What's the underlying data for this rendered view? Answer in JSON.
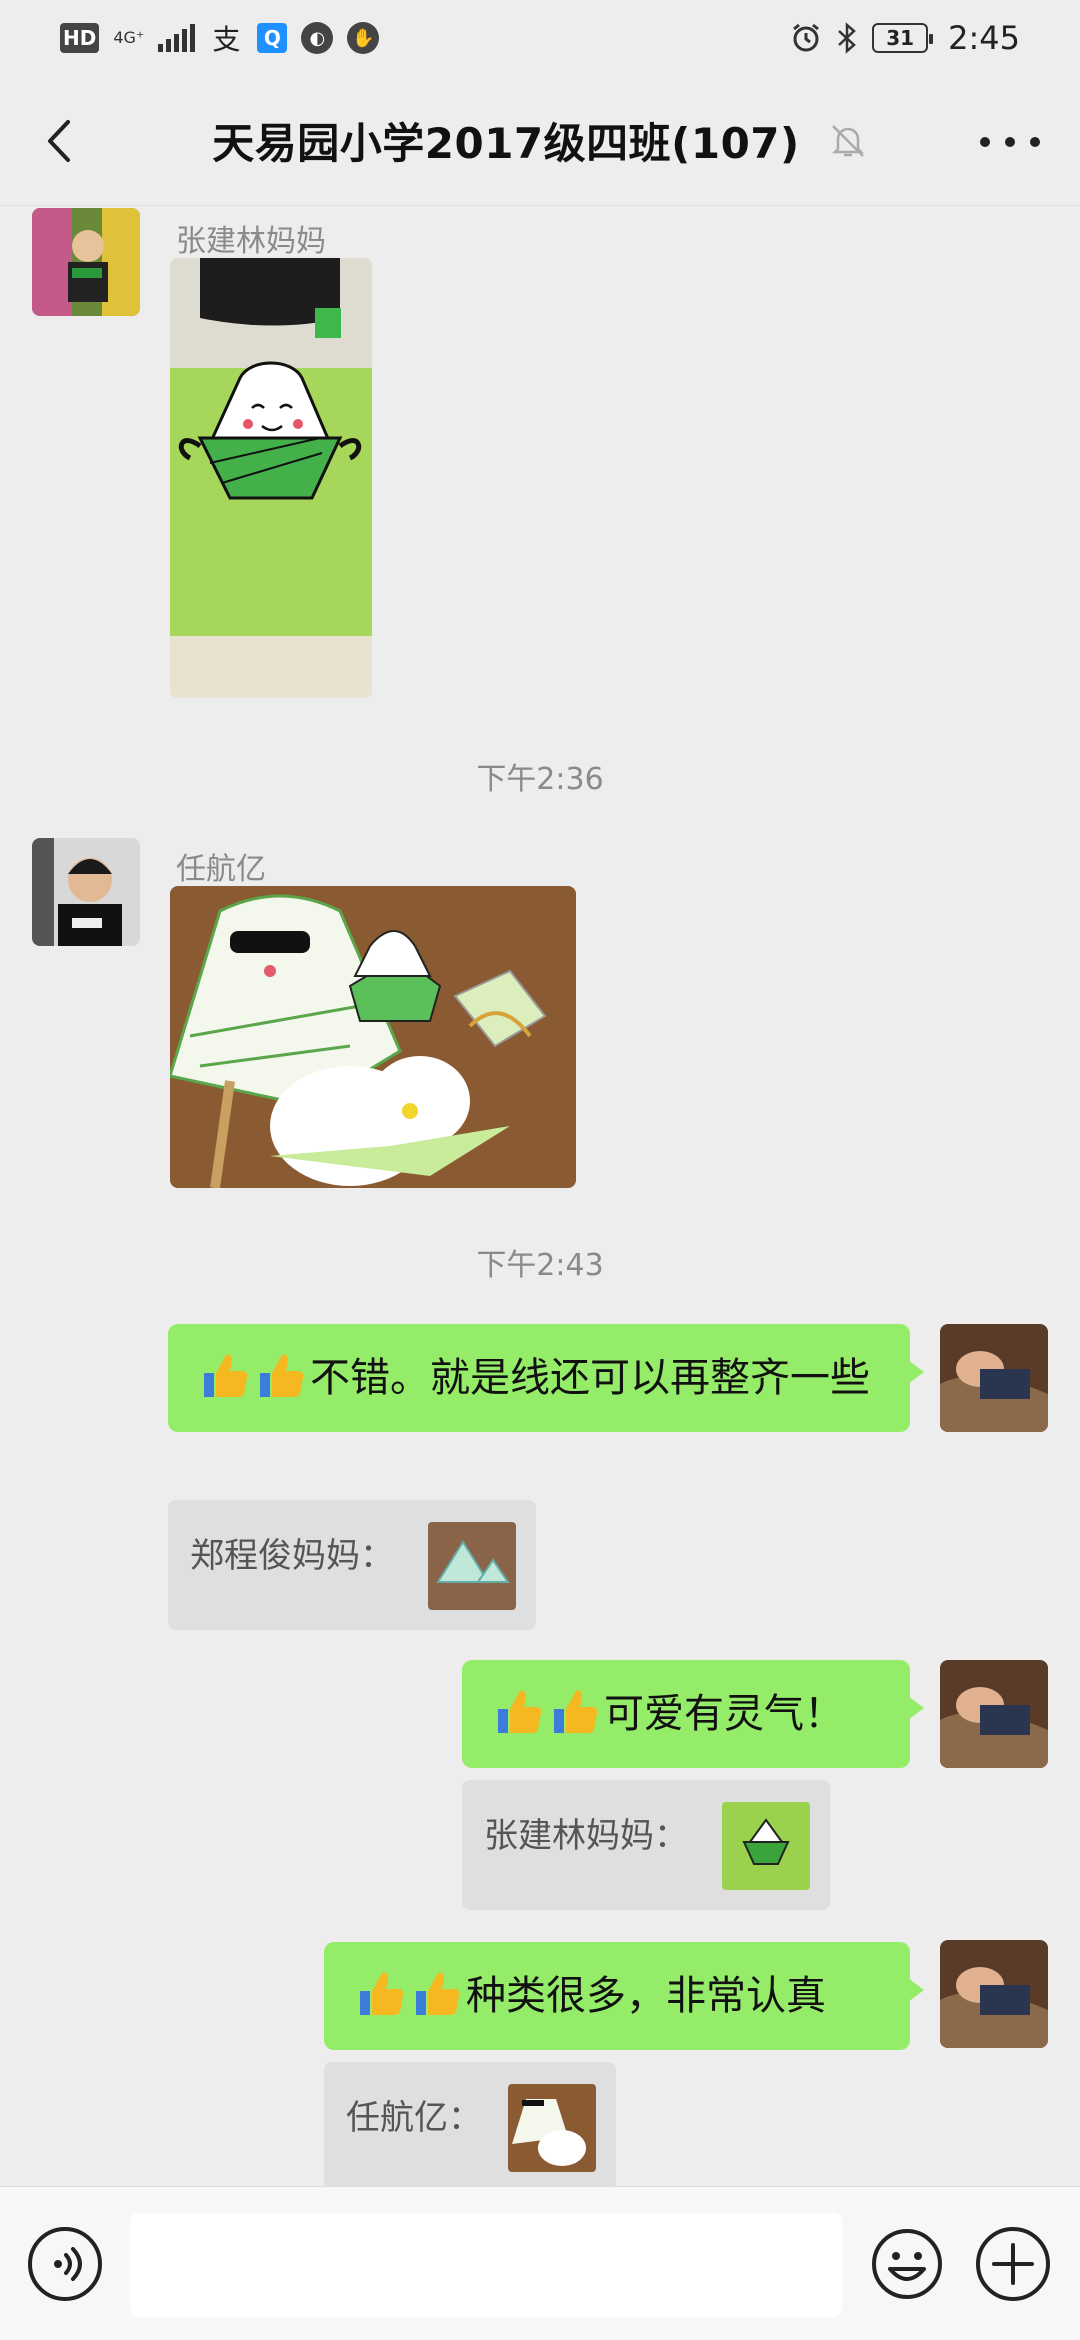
{
  "status_bar": {
    "hd": "HD",
    "network": "4G⁺",
    "alipay": "支",
    "search": "Q",
    "battery": "31",
    "time": "2:45"
  },
  "header": {
    "title": "天易园小学2017级四班(107)"
  },
  "messages": {
    "m1": {
      "sender": "张建林妈妈"
    },
    "t1": {
      "time": "下午2:36"
    },
    "m2": {
      "sender": "任航亿"
    },
    "t2": {
      "time": "下午2:43"
    },
    "m3": {
      "text": "不错。就是线还可以再整齐一些",
      "quote_name": "郑程俊妈妈："
    },
    "m4": {
      "text": "可爱有灵气！",
      "quote_name": "张建林妈妈："
    },
    "m5": {
      "text": "种类很多，非常认真",
      "quote_name": "任航亿："
    }
  },
  "input": {
    "placeholder": ""
  },
  "colors": {
    "bubble_self": "#95ec69",
    "background": "#ededed",
    "quote_bg": "#dfdfdf"
  },
  "icons": [
    "back-arrow-icon",
    "mute-bell-icon",
    "more-dots-icon",
    "voice-icon",
    "emoji-icon",
    "plus-icon",
    "thumbs-up-icon"
  ]
}
